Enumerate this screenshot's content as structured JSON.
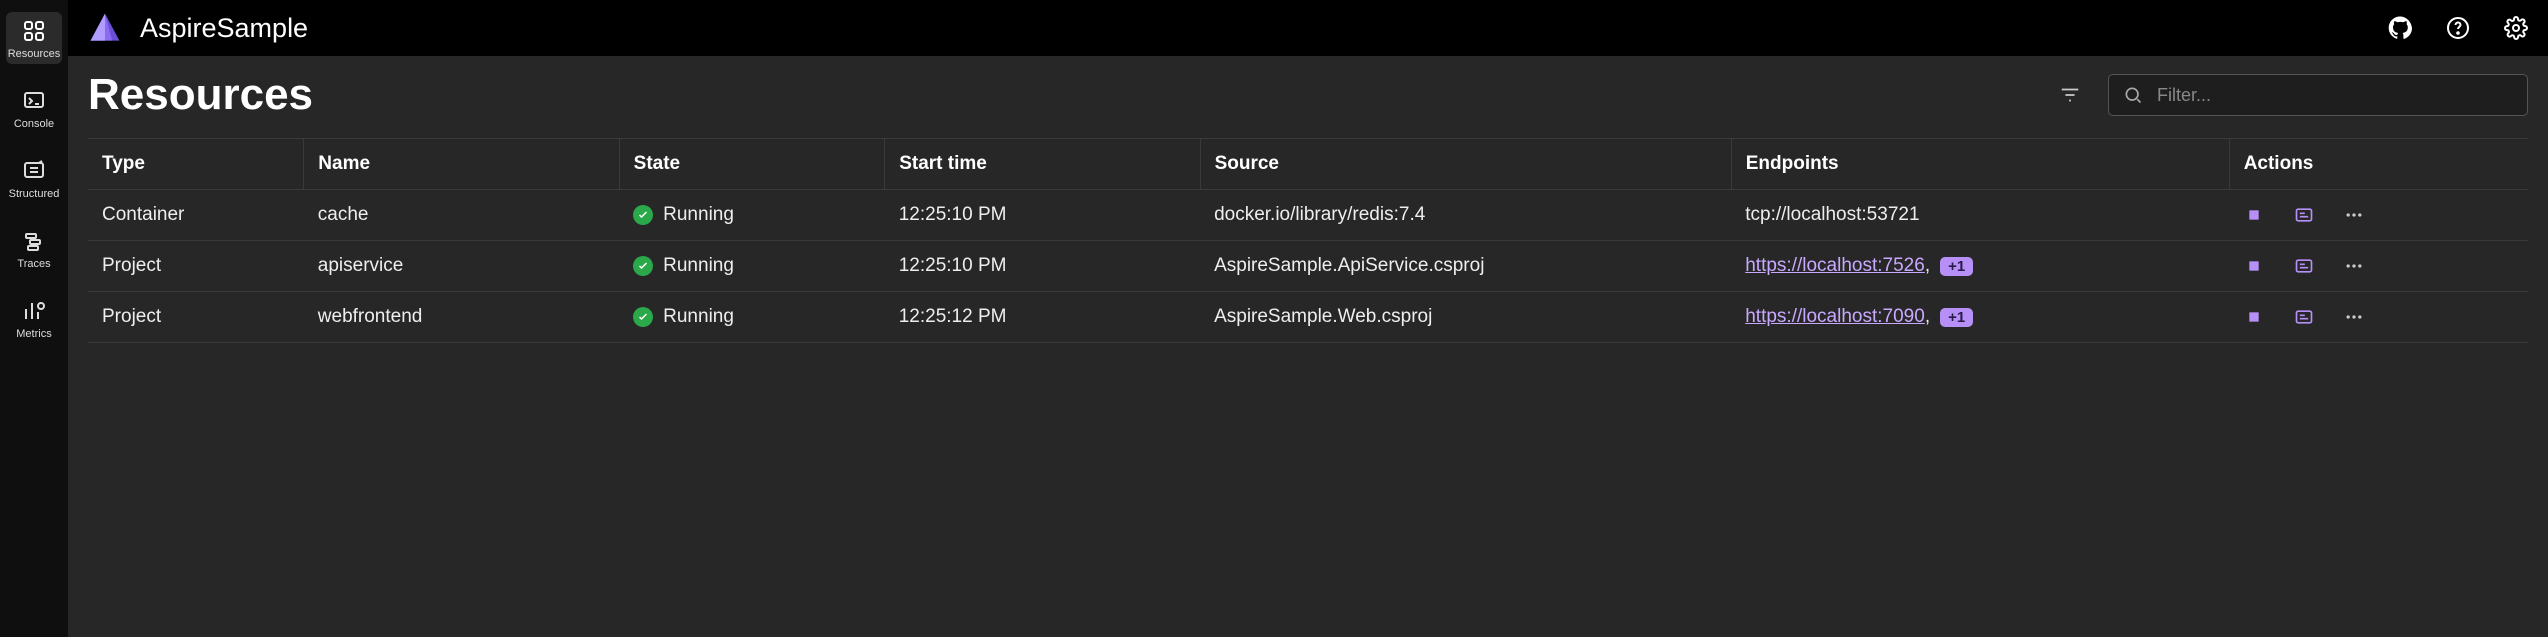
{
  "brand": "AspireSample",
  "sidebar": {
    "items": [
      {
        "label": "Resources",
        "selected": true
      },
      {
        "label": "Console",
        "selected": false
      },
      {
        "label": "Structured",
        "selected": false
      },
      {
        "label": "Traces",
        "selected": false
      },
      {
        "label": "Metrics",
        "selected": false
      }
    ]
  },
  "page": {
    "title": "Resources",
    "search_placeholder": "Filter..."
  },
  "table": {
    "columns": [
      "Type",
      "Name",
      "State",
      "Start time",
      "Source",
      "Endpoints",
      "Actions"
    ],
    "rows": [
      {
        "type": "Container",
        "name": "cache",
        "state": "Running",
        "start": "12:25:10 PM",
        "source": "docker.io/library/redis:7.4",
        "endpoint": "tcp://localhost:53721",
        "endpoint_link": false,
        "extra": ""
      },
      {
        "type": "Project",
        "name": "apiservice",
        "state": "Running",
        "start": "12:25:10 PM",
        "source": "AspireSample.ApiService.csproj",
        "endpoint": "https://localhost:7526",
        "endpoint_link": true,
        "extra": "+1"
      },
      {
        "type": "Project",
        "name": "webfrontend",
        "state": "Running",
        "start": "12:25:12 PM",
        "source": "AspireSample.Web.csproj",
        "endpoint": "https://localhost:7090",
        "endpoint_link": true,
        "extra": "+1"
      }
    ]
  }
}
